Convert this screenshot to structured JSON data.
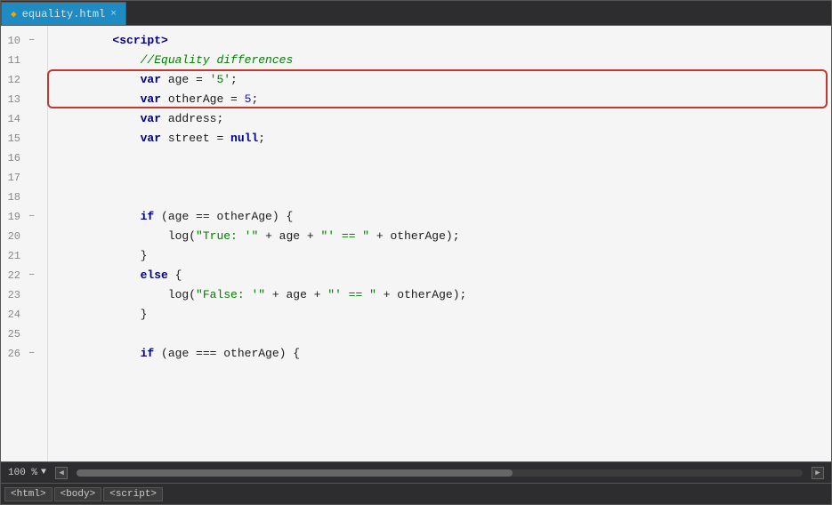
{
  "tab": {
    "filename": "equality.html",
    "icon": "◆",
    "close": "×"
  },
  "lines": [
    {
      "num": 10,
      "fold": "−",
      "content": [
        {
          "t": "        "
        },
        {
          "t": "<script>",
          "c": "kw"
        }
      ]
    },
    {
      "num": 11,
      "fold": "",
      "content": [
        {
          "t": "            "
        },
        {
          "t": "//Equality differences",
          "c": "comment"
        }
      ]
    },
    {
      "num": 12,
      "fold": "",
      "content": [
        {
          "t": "            "
        },
        {
          "t": "var",
          "c": "kw"
        },
        {
          "t": " age = "
        },
        {
          "t": "'5'",
          "c": "str"
        },
        {
          "t": ";"
        }
      ],
      "highlight": true
    },
    {
      "num": 13,
      "fold": "",
      "content": [
        {
          "t": "            "
        },
        {
          "t": "var",
          "c": "kw"
        },
        {
          "t": " otherAge = "
        },
        {
          "t": "5",
          "c": "num"
        },
        {
          "t": ";"
        }
      ],
      "highlight": true
    },
    {
      "num": 14,
      "fold": "",
      "content": [
        {
          "t": "            "
        },
        {
          "t": "var",
          "c": "kw"
        },
        {
          "t": " address;"
        }
      ]
    },
    {
      "num": 15,
      "fold": "",
      "content": [
        {
          "t": "            "
        },
        {
          "t": "var",
          "c": "kw"
        },
        {
          "t": " street = "
        },
        {
          "t": "null",
          "c": "null-kw"
        },
        {
          "t": ";"
        }
      ]
    },
    {
      "num": 16,
      "fold": "",
      "content": []
    },
    {
      "num": 17,
      "fold": "",
      "content": []
    },
    {
      "num": 18,
      "fold": "",
      "content": []
    },
    {
      "num": 19,
      "fold": "−",
      "content": [
        {
          "t": "            "
        },
        {
          "t": "if",
          "c": "kw"
        },
        {
          "t": " (age == otherAge) {"
        }
      ]
    },
    {
      "num": 20,
      "fold": "",
      "content": [
        {
          "t": "                "
        },
        {
          "t": "log"
        },
        {
          "t": "("
        },
        {
          "t": "\"True: '\"",
          "c": "str"
        },
        {
          "t": " + age + "
        },
        {
          "t": "\"' == \"",
          "c": "str"
        },
        {
          "t": " + otherAge);"
        }
      ]
    },
    {
      "num": 21,
      "fold": "",
      "content": [
        {
          "t": "            }"
        }
      ]
    },
    {
      "num": 22,
      "fold": "−",
      "content": [
        {
          "t": "            "
        },
        {
          "t": "else",
          "c": "kw"
        },
        {
          "t": " {"
        }
      ]
    },
    {
      "num": 23,
      "fold": "",
      "content": [
        {
          "t": "                "
        },
        {
          "t": "log"
        },
        {
          "t": "("
        },
        {
          "t": "\"False: '\"",
          "c": "str"
        },
        {
          "t": " + age + "
        },
        {
          "t": "\"' == \"",
          "c": "str"
        },
        {
          "t": " + otherAge);"
        }
      ]
    },
    {
      "num": 24,
      "fold": "",
      "content": [
        {
          "t": "            }"
        }
      ]
    },
    {
      "num": 25,
      "fold": "",
      "content": []
    },
    {
      "num": 26,
      "fold": "−",
      "content": [
        {
          "t": "            "
        },
        {
          "t": "if",
          "c": "kw"
        },
        {
          "t": " (age === otherAge) {"
        }
      ]
    }
  ],
  "status": {
    "zoom": "100 %",
    "zoom_arrow": "▼"
  },
  "breadcrumbs": [
    "<html>",
    "<body>",
    "<script>"
  ]
}
